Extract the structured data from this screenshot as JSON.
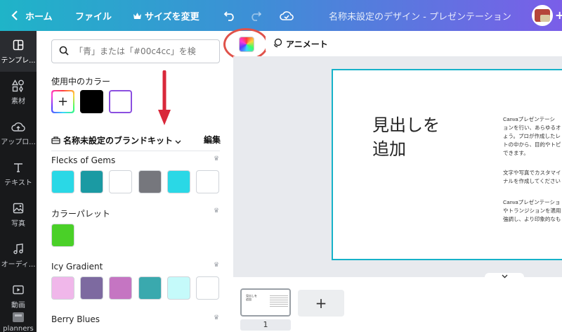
{
  "topbar": {
    "home": "ホーム",
    "file": "ファイル",
    "resize": "サイズを変更",
    "doc_title": "名称未設定のデザイン - プレゼンテーション",
    "colors": {
      "gradient_start": "#1fb4c8",
      "gradient_end": "#7a5ee8"
    }
  },
  "rail": [
    {
      "label": "テンプレ...",
      "icon": "template-icon"
    },
    {
      "label": "素材",
      "icon": "elements-icon"
    },
    {
      "label": "アップロ...",
      "icon": "upload-cloud-icon"
    },
    {
      "label": "テキスト",
      "icon": "text-icon"
    },
    {
      "label": "写真",
      "icon": "photo-icon"
    },
    {
      "label": "オーディ...",
      "icon": "audio-icon"
    },
    {
      "label": "動画",
      "icon": "video-icon"
    },
    {
      "label": "planners",
      "icon": "planners-icon"
    }
  ],
  "panel": {
    "search_placeholder": "「青」または「#00c4cc」を検",
    "used_colors_title": "使用中のカラー",
    "used_colors": [
      "#000000",
      "#ffffff"
    ],
    "brand_kit_label": "名称未設定のブランドキット",
    "edit_label": "編集",
    "palettes": [
      {
        "name": "Flecks of Gems",
        "colors": [
          "#2ad8e6",
          "#1b9aa3",
          "#ffffff",
          "#76777d",
          "#2ad8e6",
          "#ffffff"
        ]
      },
      {
        "name": "カラーパレット",
        "colors": [
          "#4ad028"
        ]
      },
      {
        "name": "Icy Gradient",
        "colors": [
          "#f0b7ea",
          "#7d6aa0",
          "#c575c2",
          "#3aa9ae",
          "#c5fafa",
          "#ffffff"
        ]
      },
      {
        "name": "Berry Blues",
        "colors": []
      }
    ]
  },
  "toolbar": {
    "animate_label": "アニメート"
  },
  "slide": {
    "heading": "見出しを\n追加",
    "body_1": "Canvaプレゼンテーシ\nョンを行い、あらゆるオ\nょう。プロが作成したレ\nトの中から、目的やトピ\nできます。",
    "body_2": "文字や写真でカスタマイ\nナルを作成してください",
    "body_3": "Canvaプレゼンテーショ\nやトランジションを適用\n強調し、より印象的なも"
  },
  "pages": {
    "thumb_heading": "見出しを\n追加",
    "page_number": "1",
    "add_page": "+"
  }
}
